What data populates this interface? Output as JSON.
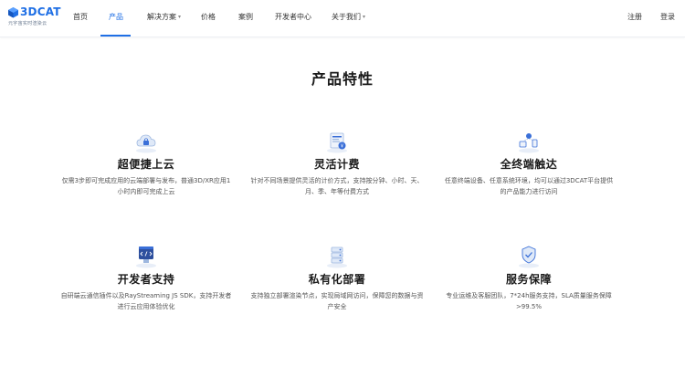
{
  "brand": {
    "name": "3DCAT",
    "tagline": "元宇宙实时渲染云",
    "accent": "#1f6fe5"
  },
  "nav": {
    "items": [
      {
        "label": "首页"
      },
      {
        "label": "产品"
      },
      {
        "label": "解决方案"
      },
      {
        "label": "价格"
      },
      {
        "label": "案例"
      },
      {
        "label": "开发者中心"
      },
      {
        "label": "关于我们"
      }
    ],
    "register": "注册",
    "login": "登录"
  },
  "section_title": "产品特性",
  "features": [
    {
      "title": "超便捷上云",
      "desc": "仅需3步即可完成应用的云端部署与发布，普通3D/XR应用1小时内即可完成上云",
      "icon": "cloud-icon"
    },
    {
      "title": "灵活计费",
      "desc": "针对不同场景提供灵活的计价方式，支持按分钟、小时、天、月、季、年等付费方式",
      "icon": "billing-icon"
    },
    {
      "title": "全终端触达",
      "desc": "任意终端设备、任意系统环境，均可以通过3DCAT平台提供的产品能力进行访问",
      "icon": "multi-device-icon"
    },
    {
      "title": "开发者支持",
      "desc": "自研端云通信插件以及RayStreaming JS SDK，支持开发者进行云应用体验优化",
      "icon": "code-icon"
    },
    {
      "title": "私有化部署",
      "desc": "支持独立部署渲染节点，实现局域网访问，保障您的数据与资产安全",
      "icon": "server-icon"
    },
    {
      "title": "服务保障",
      "desc": "专业运维及客服团队，7*24h服务支持，SLA质量服务保障>99.5%",
      "icon": "shield-icon"
    }
  ]
}
